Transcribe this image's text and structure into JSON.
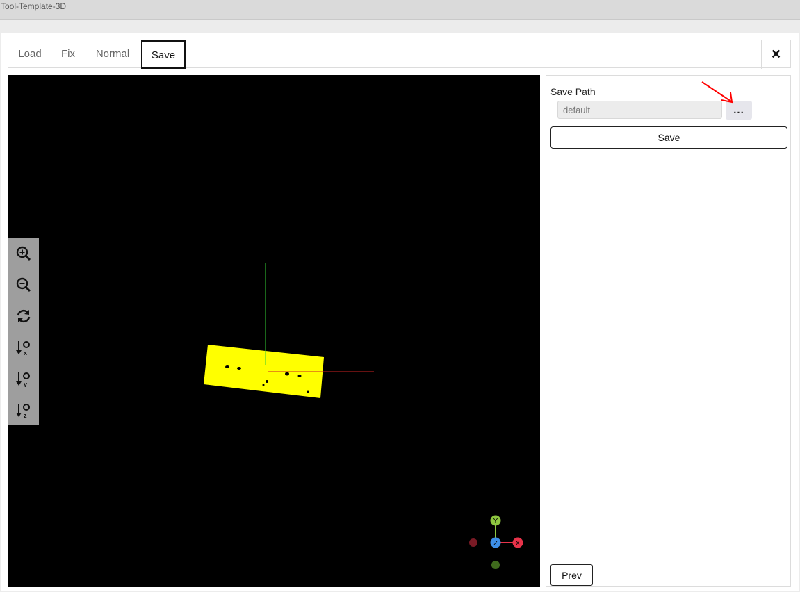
{
  "app": {
    "title": "Tool-Template-3D"
  },
  "tabs": [
    {
      "label": "Load",
      "active": false
    },
    {
      "label": "Fix",
      "active": false
    },
    {
      "label": "Normal",
      "active": false
    },
    {
      "label": "Save",
      "active": true
    }
  ],
  "close_icon": "close-icon",
  "viewer": {
    "background": "#000000",
    "model_color": "#ffff00",
    "axis_colors": {
      "x": "#cc2222",
      "y": "#33cc33"
    },
    "tools": [
      "zoom-in-icon",
      "zoom-out-icon",
      "reset-view-icon",
      "view-x-icon",
      "view-y-icon",
      "view-z-icon"
    ],
    "gizmo": {
      "x_label": "X",
      "y_label": "Y",
      "z_label": "Z",
      "x_color": "#e8334a",
      "y_color": "#8dc63f",
      "z_color": "#3d8fe8"
    }
  },
  "panel": {
    "save_path_label": "Save Path",
    "save_path_value": "default",
    "browse_label": "...",
    "save_label": "Save",
    "prev_label": "Prev"
  },
  "annotation": {
    "arrow_color": "#ff0000"
  }
}
